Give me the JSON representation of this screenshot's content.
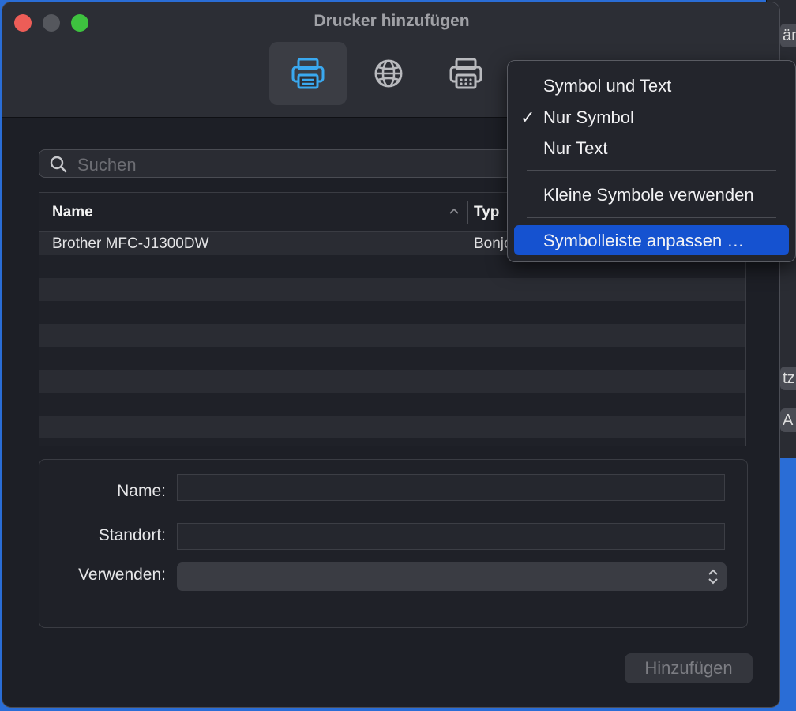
{
  "window": {
    "title": "Drucker hinzufügen"
  },
  "toolbar": {
    "buttons": [
      {
        "icon": "printer-icon",
        "active": true
      },
      {
        "icon": "globe-icon",
        "active": false
      },
      {
        "icon": "fax-printer-icon",
        "active": false
      }
    ]
  },
  "search": {
    "placeholder": "Suchen"
  },
  "table": {
    "columns": [
      "Name",
      "Typ"
    ],
    "rows": [
      {
        "name": "Brother MFC-J1300DW",
        "typ": "Bonjour"
      }
    ]
  },
  "form": {
    "name_label": "Name:",
    "name_value": "",
    "location_label": "Standort:",
    "location_value": "",
    "use_label": "Verwenden:",
    "use_value": ""
  },
  "buttons": {
    "add": "Hinzufügen"
  },
  "context_menu": {
    "items": [
      {
        "label": "Symbol und Text",
        "checked": false
      },
      {
        "label": "Nur Symbol",
        "checked": true
      },
      {
        "label": "Nur Text",
        "checked": false
      },
      {
        "label": "Kleine Symbole verwenden",
        "checked": false
      },
      {
        "label": "Symbolleiste anpassen …",
        "highlighted": true
      }
    ],
    "check_glyph": "✓"
  },
  "background_window": {
    "fragments": [
      "än",
      "tz",
      "A"
    ]
  },
  "colors": {
    "accent_icon": "#3aa9f0",
    "menu_highlight": "#1552d0"
  }
}
